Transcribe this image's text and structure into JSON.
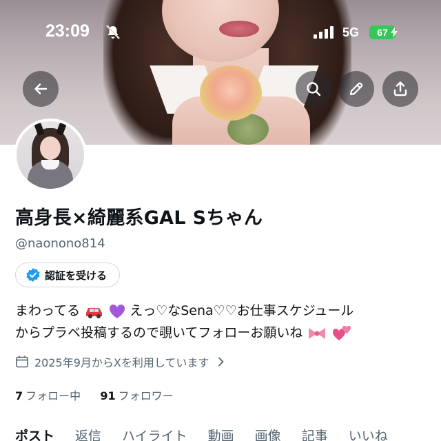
{
  "status_bar": {
    "time": "23:09",
    "network": "5G",
    "battery": "67"
  },
  "profile": {
    "display_name": "高身長×綺麗系GAL Sちゃん",
    "handle": "@naonono814",
    "verify_label": "認証を受ける",
    "bio_line1_a": "まわってる",
    "bio_line1_b": "えっ♡なSena♡♡お仕事スケジュール",
    "bio_line2": "からプラベ投稿するので覗いてフォローお願いね",
    "joined": "2025年9月からXを利用しています",
    "following_count": "7",
    "following_label": "フォロー中",
    "followers_count": "91",
    "followers_label": "フォロワー"
  },
  "tabs": [
    "ポスト",
    "返信",
    "ハイライト",
    "動画",
    "画像",
    "記事",
    "いいね"
  ],
  "icons": {
    "back": "arrow-left-icon",
    "search": "search-icon",
    "edit": "pencil-icon",
    "share": "share-icon",
    "verified": "verified-badge-icon",
    "calendar": "calendar-icon"
  },
  "colors": {
    "accent": "#1d9bf0",
    "battery": "#34c759",
    "text_secondary": "#536471"
  }
}
